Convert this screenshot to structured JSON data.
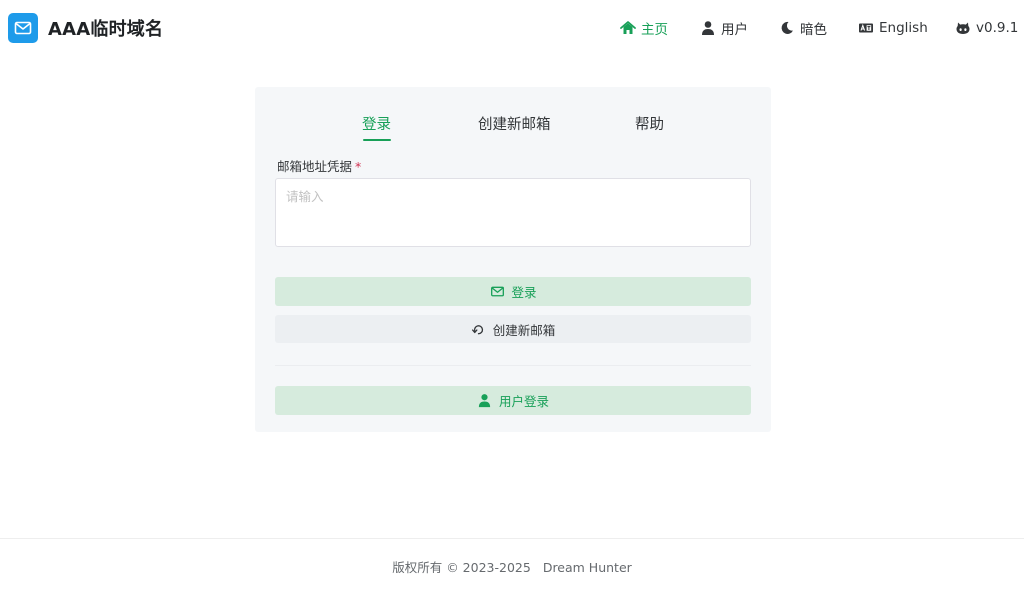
{
  "header": {
    "title": "AAA临时域名",
    "nav": [
      {
        "label": "主页",
        "icon": "home-icon"
      },
      {
        "label": "用户",
        "icon": "user-icon"
      },
      {
        "label": "暗色",
        "icon": "moon-icon"
      },
      {
        "label": "English",
        "icon": "translate-icon"
      },
      {
        "label": "v0.9.1",
        "icon": "github-icon"
      }
    ]
  },
  "card": {
    "tabs": [
      {
        "label": "登录",
        "active": true
      },
      {
        "label": "创建新邮箱",
        "active": false
      },
      {
        "label": "帮助",
        "active": false
      }
    ],
    "field": {
      "label": "邮箱地址凭据",
      "required_mark": "*",
      "value": "",
      "placeholder": "请输入"
    },
    "login_button": {
      "label": "登录",
      "icon": "mail-icon"
    },
    "create_button": {
      "label": "创建新邮箱",
      "icon": "refresh-icon"
    },
    "user_login_button": {
      "label": "用户登录",
      "icon": "user-icon"
    }
  },
  "footer": {
    "copyright": "版权所有 © 2023-2025",
    "author": "Dream Hunter"
  },
  "colors": {
    "accent": "#18a058",
    "brand_logo": "#1e9bea",
    "primary_button_bg": "#d6ebdd",
    "secondary_button_bg": "#eceff2",
    "card_bg": "#f5f7f9",
    "required": "#d03050"
  }
}
